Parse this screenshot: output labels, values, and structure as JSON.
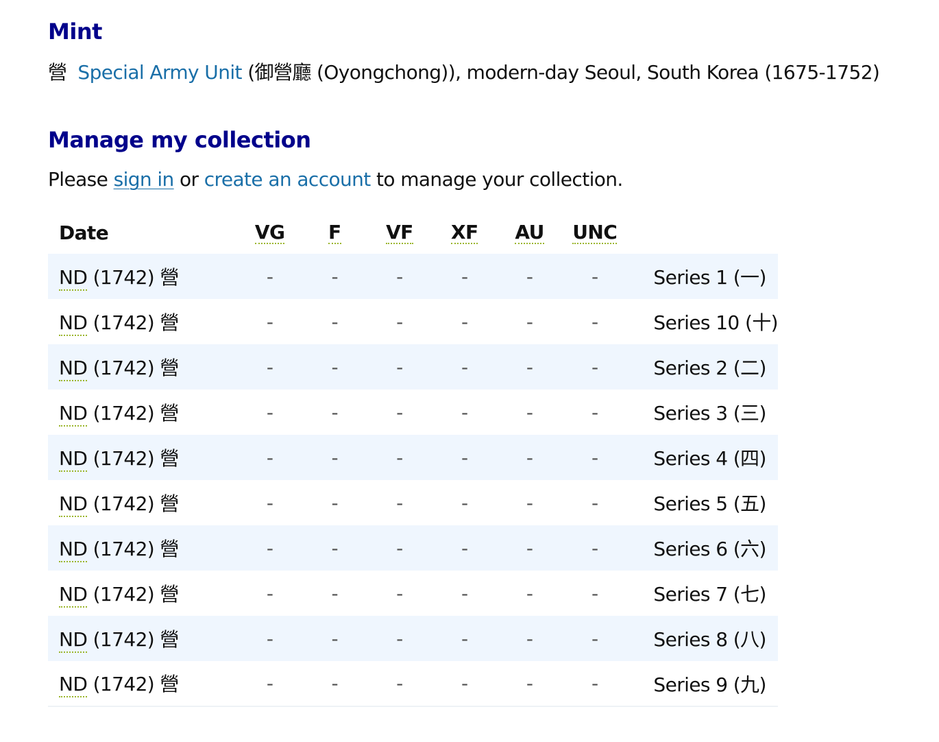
{
  "mint": {
    "heading": "Mint",
    "mark": "營",
    "name_link": "Special Army Unit",
    "details": " (御營廳 (Oyongchong)), modern-day Seoul, South Korea (1675-1752)"
  },
  "collection": {
    "heading": "Manage my collection",
    "prefix": "Please ",
    "sign_in": "sign in",
    "middle": " or ",
    "create_account": "create an account",
    "suffix": " to manage your collection."
  },
  "table": {
    "headers": {
      "date": "Date",
      "vg": "VG",
      "f": "F",
      "vf": "VF",
      "xf": "XF",
      "au": "AU",
      "unc": "UNC"
    },
    "rows": [
      {
        "nd": "ND",
        "rest": " (1742) 營",
        "vg": "-",
        "f": "-",
        "vf": "-",
        "xf": "-",
        "au": "-",
        "unc": "-",
        "series": "Series 1 (一)"
      },
      {
        "nd": "ND",
        "rest": " (1742) 營",
        "vg": "-",
        "f": "-",
        "vf": "-",
        "xf": "-",
        "au": "-",
        "unc": "-",
        "series": "Series 10 (十)"
      },
      {
        "nd": "ND",
        "rest": " (1742) 營",
        "vg": "-",
        "f": "-",
        "vf": "-",
        "xf": "-",
        "au": "-",
        "unc": "-",
        "series": "Series 2 (二)"
      },
      {
        "nd": "ND",
        "rest": " (1742) 營",
        "vg": "-",
        "f": "-",
        "vf": "-",
        "xf": "-",
        "au": "-",
        "unc": "-",
        "series": "Series 3 (三)"
      },
      {
        "nd": "ND",
        "rest": " (1742) 營",
        "vg": "-",
        "f": "-",
        "vf": "-",
        "xf": "-",
        "au": "-",
        "unc": "-",
        "series": "Series 4 (四)"
      },
      {
        "nd": "ND",
        "rest": " (1742) 營",
        "vg": "-",
        "f": "-",
        "vf": "-",
        "xf": "-",
        "au": "-",
        "unc": "-",
        "series": "Series 5 (五)"
      },
      {
        "nd": "ND",
        "rest": " (1742) 營",
        "vg": "-",
        "f": "-",
        "vf": "-",
        "xf": "-",
        "au": "-",
        "unc": "-",
        "series": "Series 6 (六)"
      },
      {
        "nd": "ND",
        "rest": " (1742) 營",
        "vg": "-",
        "f": "-",
        "vf": "-",
        "xf": "-",
        "au": "-",
        "unc": "-",
        "series": "Series 7 (七)"
      },
      {
        "nd": "ND",
        "rest": " (1742) 營",
        "vg": "-",
        "f": "-",
        "vf": "-",
        "xf": "-",
        "au": "-",
        "unc": "-",
        "series": "Series 8 (八)"
      },
      {
        "nd": "ND",
        "rest": " (1742) 營",
        "vg": "-",
        "f": "-",
        "vf": "-",
        "xf": "-",
        "au": "-",
        "unc": "-",
        "series": "Series 9 (九)"
      }
    ]
  }
}
